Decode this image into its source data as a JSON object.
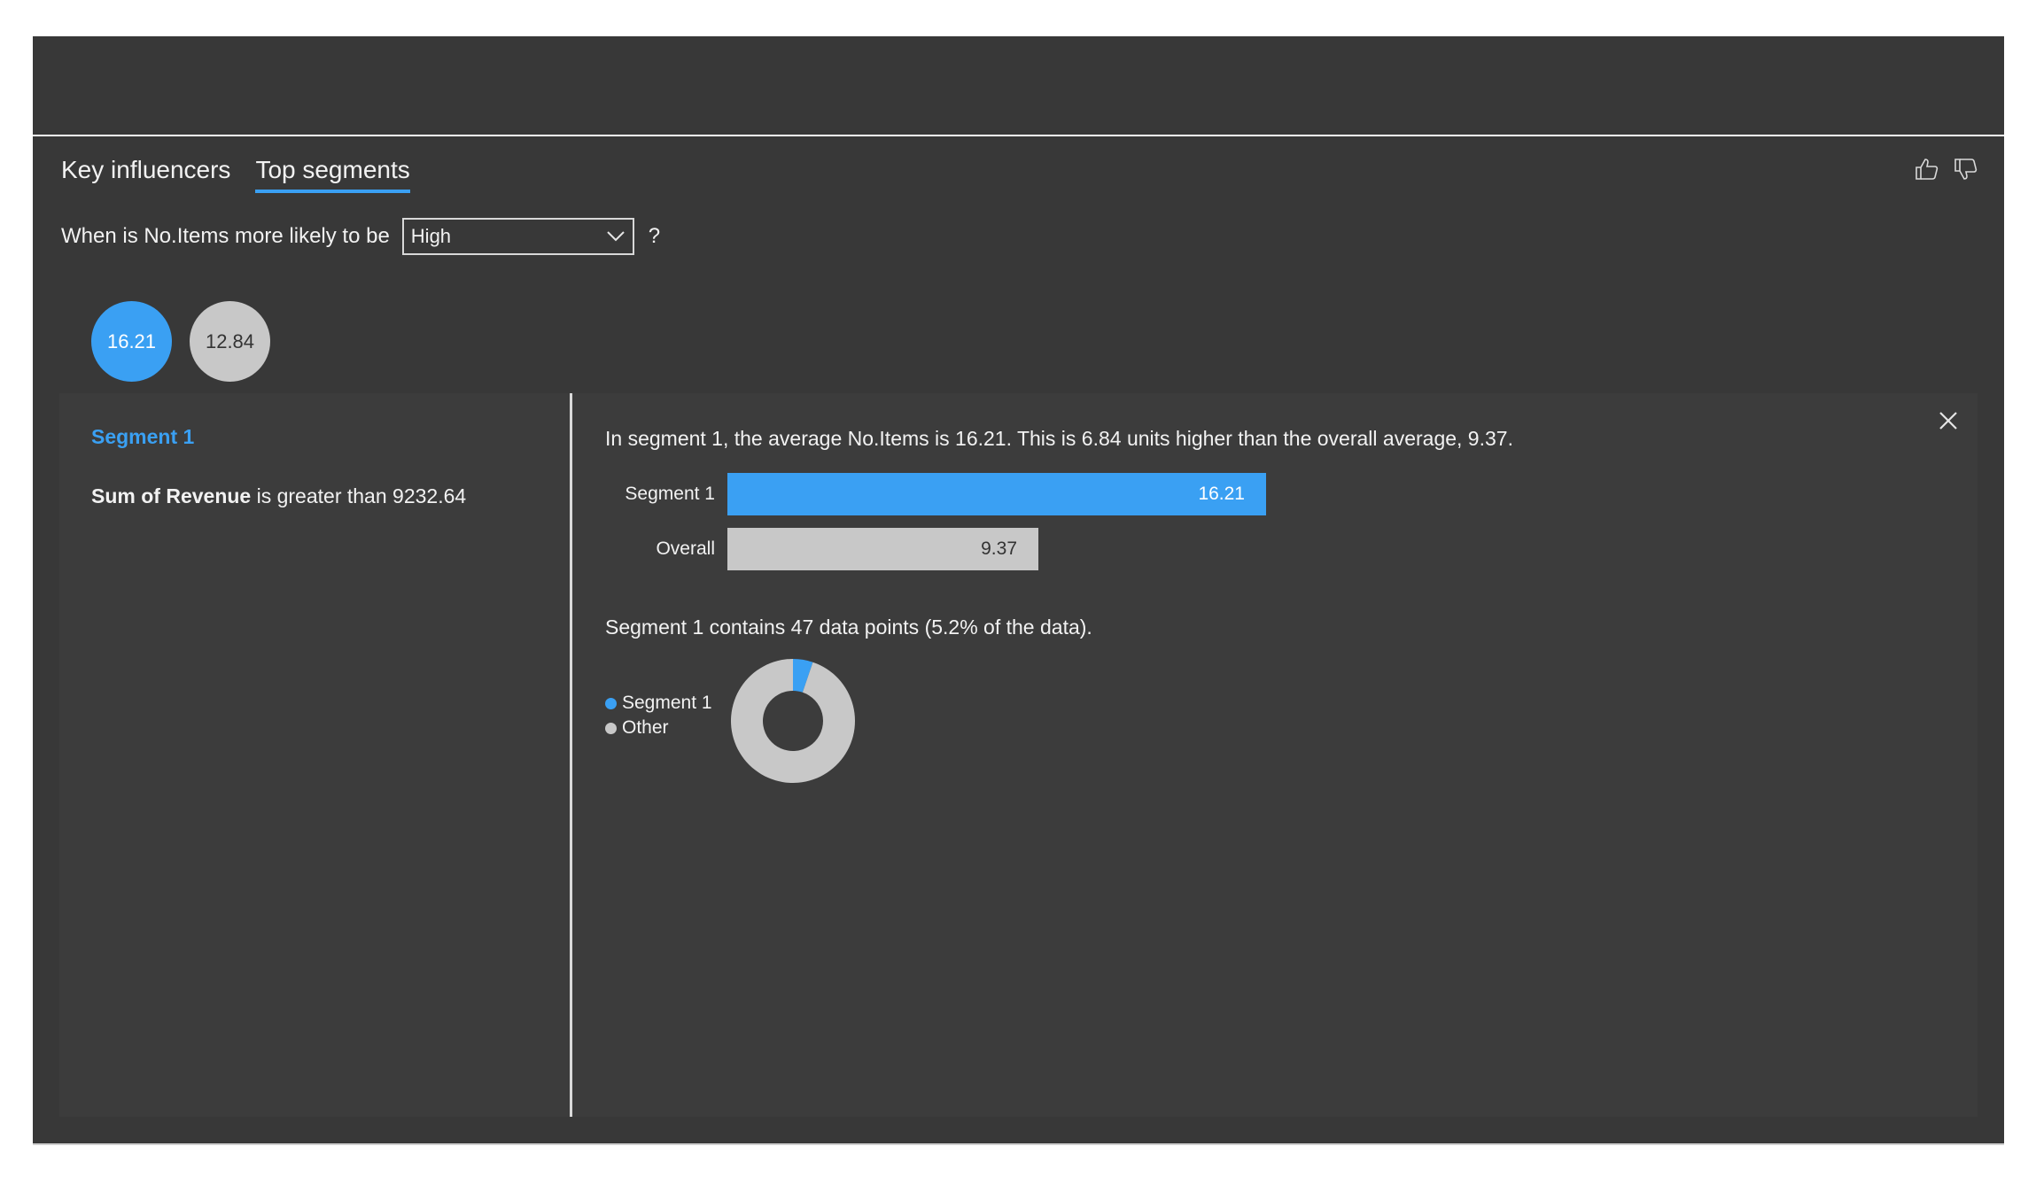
{
  "tabs": [
    {
      "label": "Key influencers"
    },
    {
      "label": "Top segments"
    }
  ],
  "question": {
    "prefix": "When is No.Items more likely to be",
    "selected": "High",
    "suffix": "?"
  },
  "bubbles": [
    "16.21",
    "12.84"
  ],
  "segment": {
    "title": "Segment 1",
    "condition_field": "Sum of Revenue",
    "condition_text": " is greater than 9232.64"
  },
  "details": {
    "summary": "In segment 1, the average No.Items is 16.21. This is 6.84 units higher than the overall average, 9.37.",
    "points_text": "Segment 1 contains 47 data points (5.2% of the data).",
    "legend": [
      "Segment 1",
      "Other"
    ]
  },
  "chart_data": [
    {
      "type": "bar",
      "categories": [
        "Segment 1",
        "Overall"
      ],
      "values": [
        16.21,
        9.37
      ],
      "labels": [
        "16.21",
        "9.37"
      ],
      "colors": [
        "#3aa0f3",
        "#c8c8c8"
      ]
    },
    {
      "type": "pie",
      "categories": [
        "Segment 1",
        "Other"
      ],
      "values": [
        5.2,
        94.8
      ],
      "colors": [
        "#3aa0f3",
        "#c8c8c8"
      ]
    }
  ],
  "colors": {
    "accent": "#3aa0f3",
    "background": "#383838",
    "neutral": "#c8c8c8"
  },
  "icons": {
    "like": "thumbs-up-icon",
    "dislike": "thumbs-down-icon",
    "close": "close-icon",
    "dropdown": "chevron-down-icon"
  }
}
